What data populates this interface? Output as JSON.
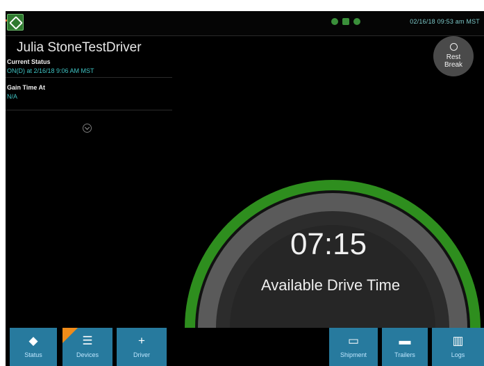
{
  "statusbar": {
    "datetime": "02/16/18 09:53 am MST"
  },
  "driver": {
    "name": "Julia StoneTestDriver"
  },
  "current_status": {
    "label": "Current Status",
    "value": "ON(D) at 2/16/18 9:06 AM MST"
  },
  "gain_time": {
    "label": "Gain Time At",
    "value": "N/A"
  },
  "rest_break": {
    "label_line1": "Rest",
    "label_line2": "Break"
  },
  "gauge": {
    "time": "07:15",
    "label": "Available Drive Time"
  },
  "nav": {
    "items": [
      {
        "label": "Status",
        "icon": "status-icon"
      },
      {
        "label": "Devices",
        "icon": "list-icon"
      },
      {
        "label": "Driver",
        "icon": "plus-icon"
      },
      {
        "label": "Shipment",
        "icon": "clipboard-icon"
      },
      {
        "label": "Trailers",
        "icon": "trailer-icon"
      },
      {
        "label": "Logs",
        "icon": "book-icon"
      }
    ]
  },
  "colors": {
    "accent": "#277a9e",
    "status_value": "#3fc3c3",
    "gauge_green": "#2e8e1e",
    "gauge_gray": "#5a5a5a",
    "badge_orange": "#f08c1a"
  }
}
